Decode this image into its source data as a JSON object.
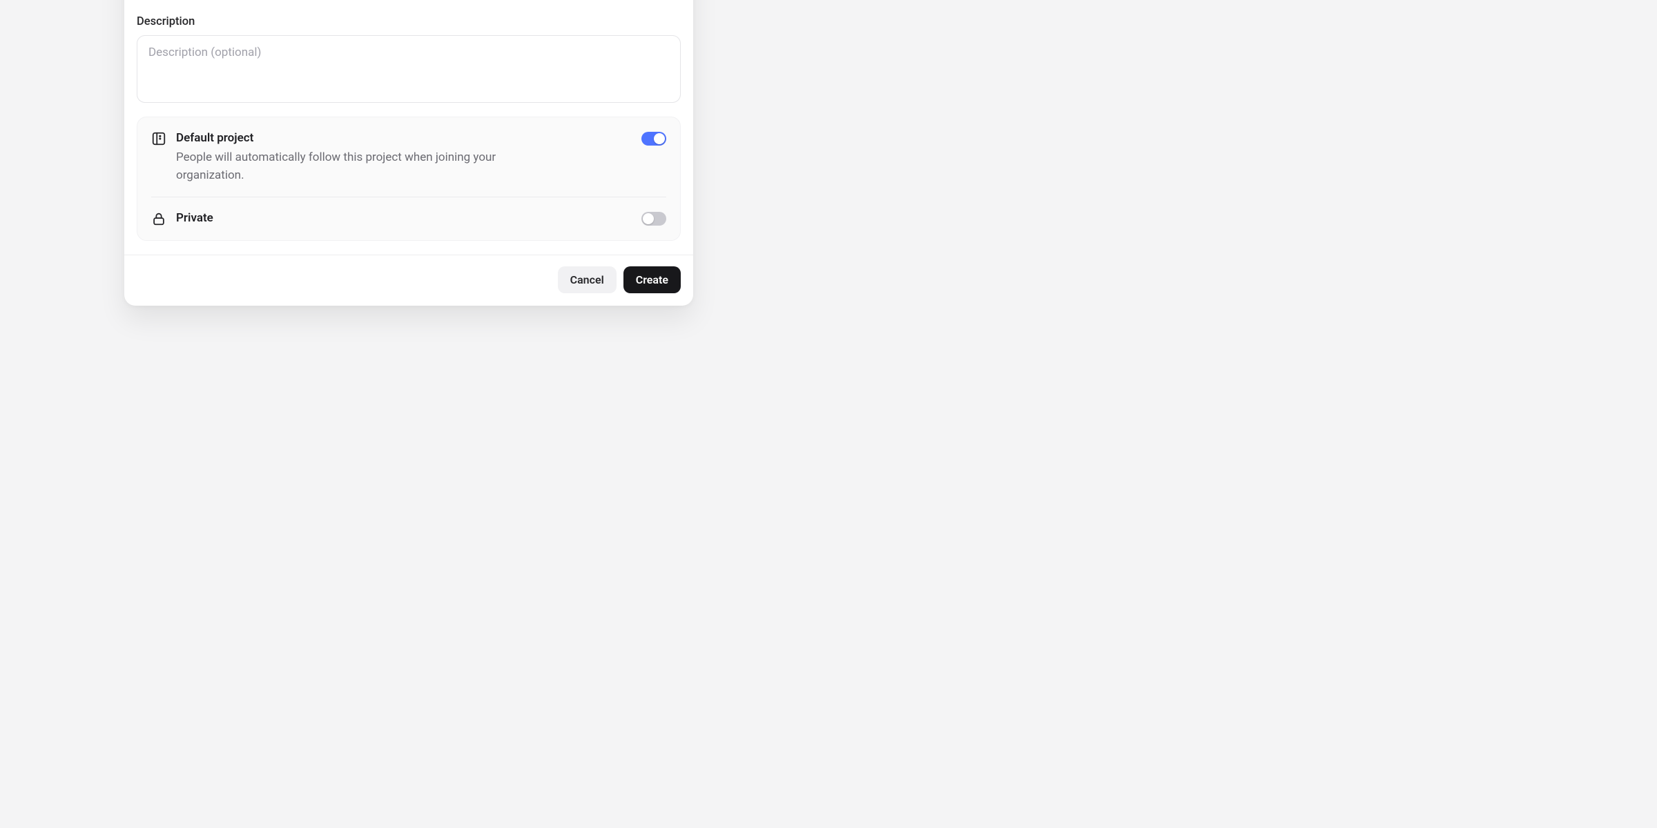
{
  "form": {
    "description_label": "Description",
    "description_placeholder": "Description (optional)",
    "description_value": ""
  },
  "settings": {
    "default_project": {
      "title": "Default project",
      "description": "People will automatically follow this project when joining your organization.",
      "enabled": true
    },
    "private": {
      "title": "Private",
      "enabled": false
    }
  },
  "actions": {
    "cancel": "Cancel",
    "create": "Create"
  }
}
